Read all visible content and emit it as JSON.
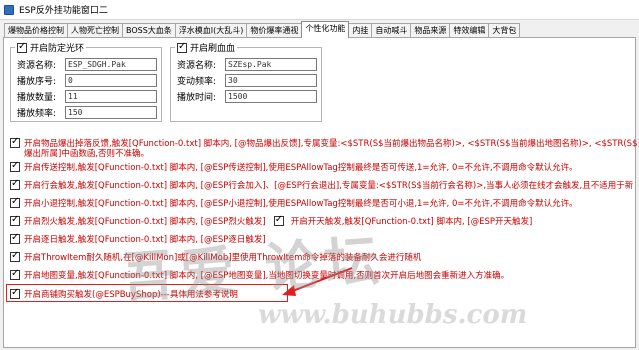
{
  "window": {
    "title": "ESP反外挂功能窗口二"
  },
  "tabs": [
    {
      "label": "爆物品价格控制",
      "active": false
    },
    {
      "label": "人物死亡控制",
      "active": false
    },
    {
      "label": "BOSS大血条",
      "active": false
    },
    {
      "label": "浮水模血I(大乱斗)",
      "active": false
    },
    {
      "label": "物价爆率通视",
      "active": false
    },
    {
      "label": "个性化功能",
      "active": true
    },
    {
      "label": "内挂",
      "active": false
    },
    {
      "label": "自动喊斗",
      "active": false
    },
    {
      "label": "物品来源",
      "active": false
    },
    {
      "label": "特效编辑",
      "active": false
    },
    {
      "label": "大背包",
      "active": false
    }
  ],
  "group_left": {
    "legend": "开启防定光环",
    "checked": true,
    "fields": [
      {
        "label": "资源名称:",
        "value": "ESP_SDGH.Pak"
      },
      {
        "label": "播放序号:",
        "value": "0"
      },
      {
        "label": "播放数量:",
        "value": "11"
      },
      {
        "label": "播放频率:",
        "value": "150"
      }
    ]
  },
  "group_right": {
    "legend": "开启刷血血",
    "checked": true,
    "fields": [
      {
        "label": "资源名称:",
        "value": "SZEsp.Pak"
      },
      {
        "label": "变动频率:",
        "value": "30"
      },
      {
        "label": "播放时间:",
        "value": "1500"
      }
    ]
  },
  "options": [
    {
      "text": "开启物品爆出掉落反馈,触发[QFunction-0.txt] 脚本内, [@物品爆出反馈],专属变量:<$STR(S$当前爆出物品名称)>, <$STR(S$当前爆出地图名称)>, <$STR(S$当前",
      "checked": true
    },
    {
      "text": "爆出所属]中函数函,否则不准确。",
      "checked": false,
      "continuation": true
    },
    {
      "text": "开启传送控制,触发[QFunction-0.txt] 脚本内, [@ESP传送控制],使用ESPAllowTag控制最终是否可传送,1=允许, 0=不允许,不调用命令默认允许。",
      "checked": true
    },
    {
      "text": "开启行会触发,触发[QFunction-0.txt] 脚本内, [@ESP行会加入]、[@ESP行会退出],专属变量:<$STR(S$当前行会名称)>,当事人必须在线才会触发,且不适用于新",
      "checked": true
    },
    {
      "text": "开启小退控制,触发[QFunction-0.txt] 脚本内, [@ESP小退控制],使用ESPAllowTag控制最终是否可小退,1=允许, 0=不允许,不调用命令默认允许。",
      "checked": true
    },
    {
      "text": "开启烈火触发,触发[QFunction-0.txt] 脚本内, [@ESP烈火触发]",
      "checked": true,
      "second": {
        "text": "开启开天触发,触发[QFunction-0.txt] 脚本内, [@ESP开天触发]",
        "checked": true
      }
    },
    {
      "text": "开启逐日触发,触发[QFunction-0.txt] 脚本内, [@ESP逐日触发]",
      "checked": true
    },
    {
      "text": "开启ThrowItem耐久随机,在[@KillMon]或[@KillMob]里使用ThrowItem命令掉落的装备耐久会进行随机",
      "checked": true
    },
    {
      "text": "开启地图变量,触发[QFunction-0.txt] 脚本内, [@ESP地图变量],当地图切换变量时调用,否则首次开启后地图会重新进入方准确。",
      "checked": true
    },
    {
      "text": "开启商铺购买触发(@ESPBuyShop)---具体用法参考说明",
      "checked": true
    }
  ],
  "watermark": {
    "text": "吾爱 论坛",
    "url": "www.buhubbs.com"
  },
  "colors": {
    "option_text": "#cc0000",
    "highlight_box": "#e02020",
    "active_tab": "#ffffff"
  }
}
